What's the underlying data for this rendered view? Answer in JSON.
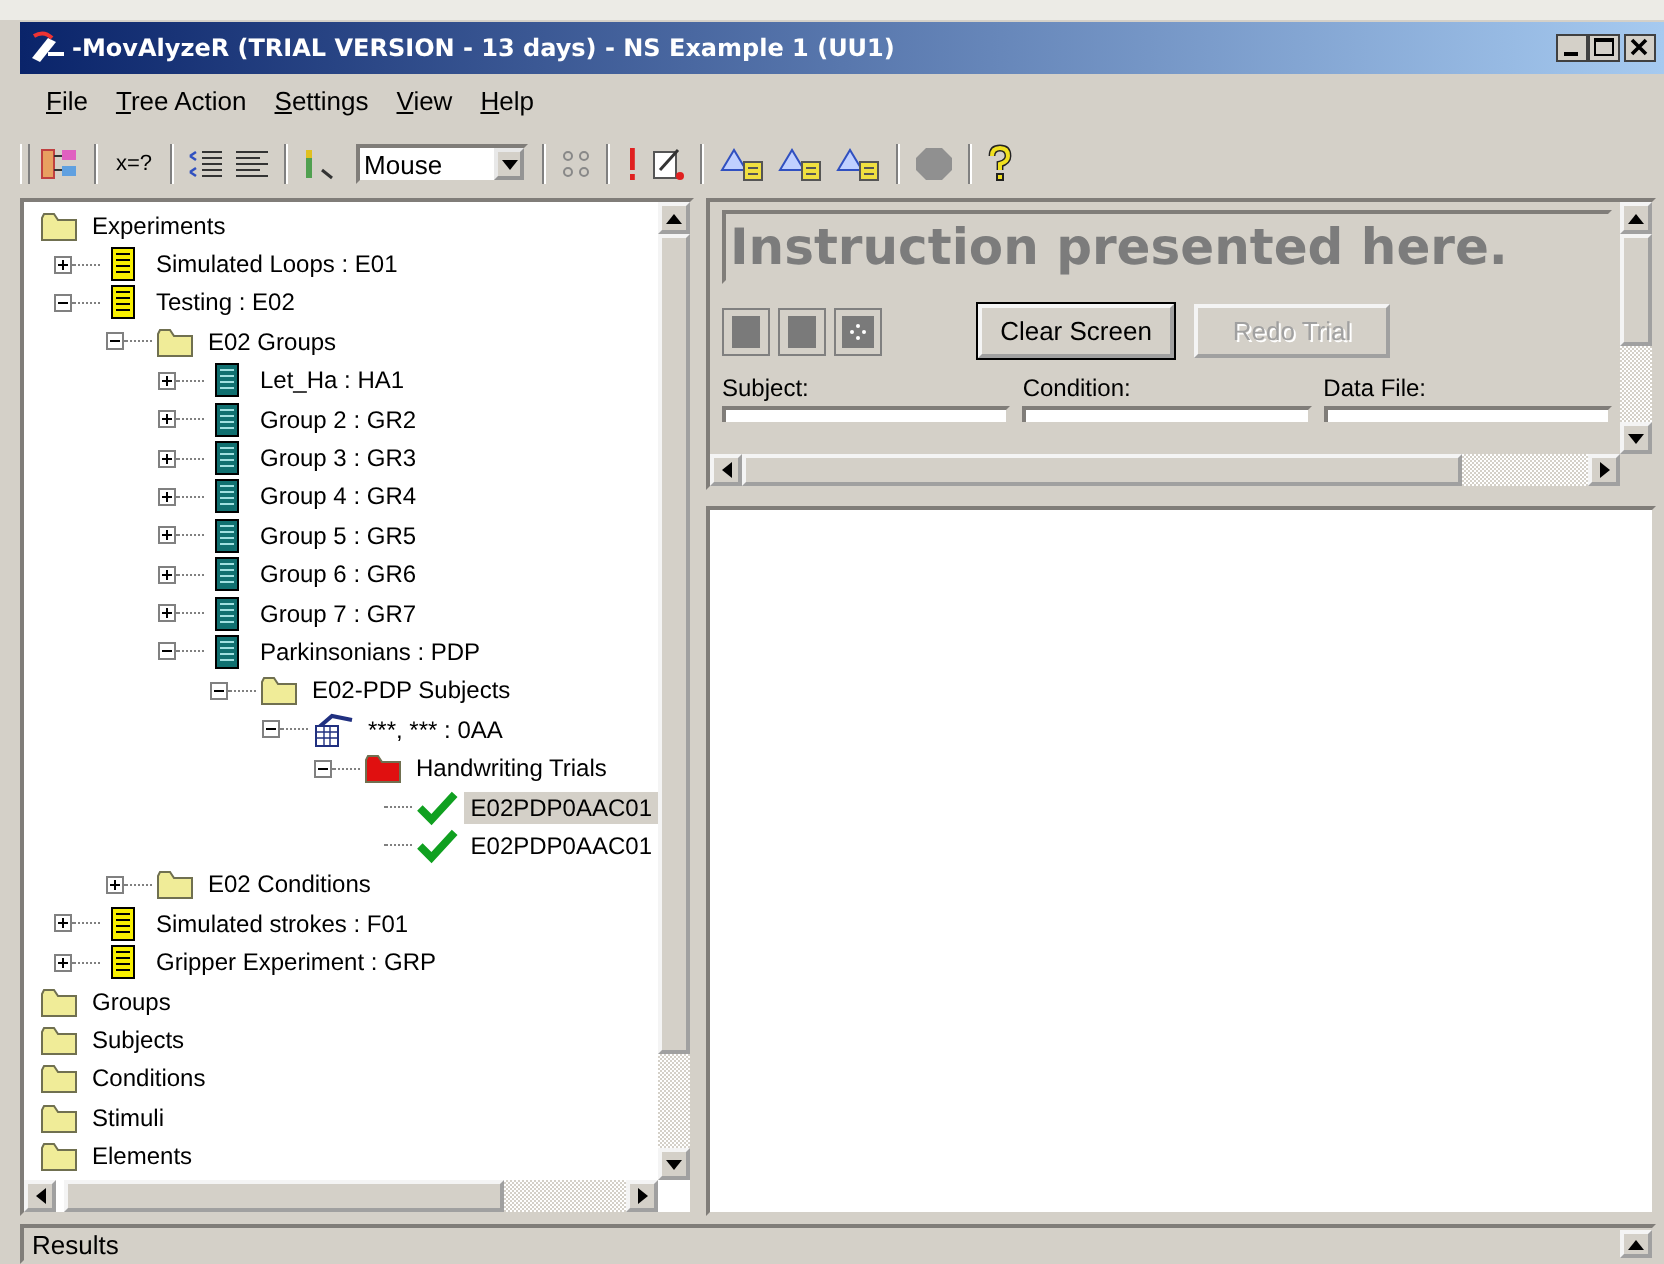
{
  "window": {
    "title": "-MovAlyzeR (TRIAL VERSION - 13 days) - NS Example 1 (UU1)"
  },
  "menu": [
    "File",
    "Tree Action",
    "Settings",
    "View",
    "Help"
  ],
  "toolbar": {
    "formula_button": "x=?",
    "input_device": "Mouse"
  },
  "tree": [
    {
      "label": "Experiments",
      "kind": "folder",
      "children": [
        {
          "label": "Simulated Loops : E01",
          "kind": "experiment",
          "expanded": false
        },
        {
          "label": "Testing : E02",
          "kind": "experiment",
          "expanded": true,
          "children": [
            {
              "label": "E02 Groups",
              "kind": "folder",
              "expanded": true,
              "children": [
                {
                  "label": "Let_Ha : HA1",
                  "kind": "group",
                  "expanded": false
                },
                {
                  "label": "Group 2 : GR2",
                  "kind": "group",
                  "expanded": false
                },
                {
                  "label": "Group 3 : GR3",
                  "kind": "group",
                  "expanded": false
                },
                {
                  "label": "Group 4 : GR4",
                  "kind": "group",
                  "expanded": false
                },
                {
                  "label": "Group 5 : GR5",
                  "kind": "group",
                  "expanded": false
                },
                {
                  "label": "Group 6 : GR6",
                  "kind": "group",
                  "expanded": false
                },
                {
                  "label": "Group 7 : GR7",
                  "kind": "group",
                  "expanded": false
                },
                {
                  "label": "Parkinsonians : PDP",
                  "kind": "group",
                  "expanded": true,
                  "children": [
                    {
                      "label": "E02-PDP Subjects",
                      "kind": "folder",
                      "expanded": true,
                      "children": [
                        {
                          "label": "***, *** : 0AA",
                          "kind": "subject",
                          "expanded": true,
                          "children": [
                            {
                              "label": "Handwriting Trials",
                              "kind": "trial-folder",
                              "expanded": true,
                              "children": [
                                {
                                  "label": "E02PDP0AAC01",
                                  "kind": "trial",
                                  "selected": true
                                },
                                {
                                  "label": "E02PDP0AAC01",
                                  "kind": "trial",
                                  "selected": false
                                }
                              ]
                            }
                          ]
                        }
                      ]
                    }
                  ]
                }
              ]
            },
            {
              "label": "E02 Conditions",
              "kind": "folder",
              "expanded": false
            }
          ]
        },
        {
          "label": "Simulated strokes : F01",
          "kind": "experiment",
          "expanded": false
        },
        {
          "label": "Gripper Experiment : GRP",
          "kind": "experiment",
          "expanded": false
        }
      ]
    },
    {
      "label": "Groups",
      "kind": "folder"
    },
    {
      "label": "Subjects",
      "kind": "folder"
    },
    {
      "label": "Conditions",
      "kind": "folder"
    },
    {
      "label": "Stimuli",
      "kind": "folder"
    },
    {
      "label": "Elements",
      "kind": "folder"
    }
  ],
  "instruction": {
    "text": "Instruction presented here.",
    "buttons": [
      {
        "label": "Clear Screen",
        "disabled": false
      },
      {
        "label": "Redo Trial",
        "disabled": true
      }
    ],
    "fields": [
      "Subject:",
      "Condition:",
      "Data File:"
    ]
  },
  "results": {
    "label": "Results"
  }
}
